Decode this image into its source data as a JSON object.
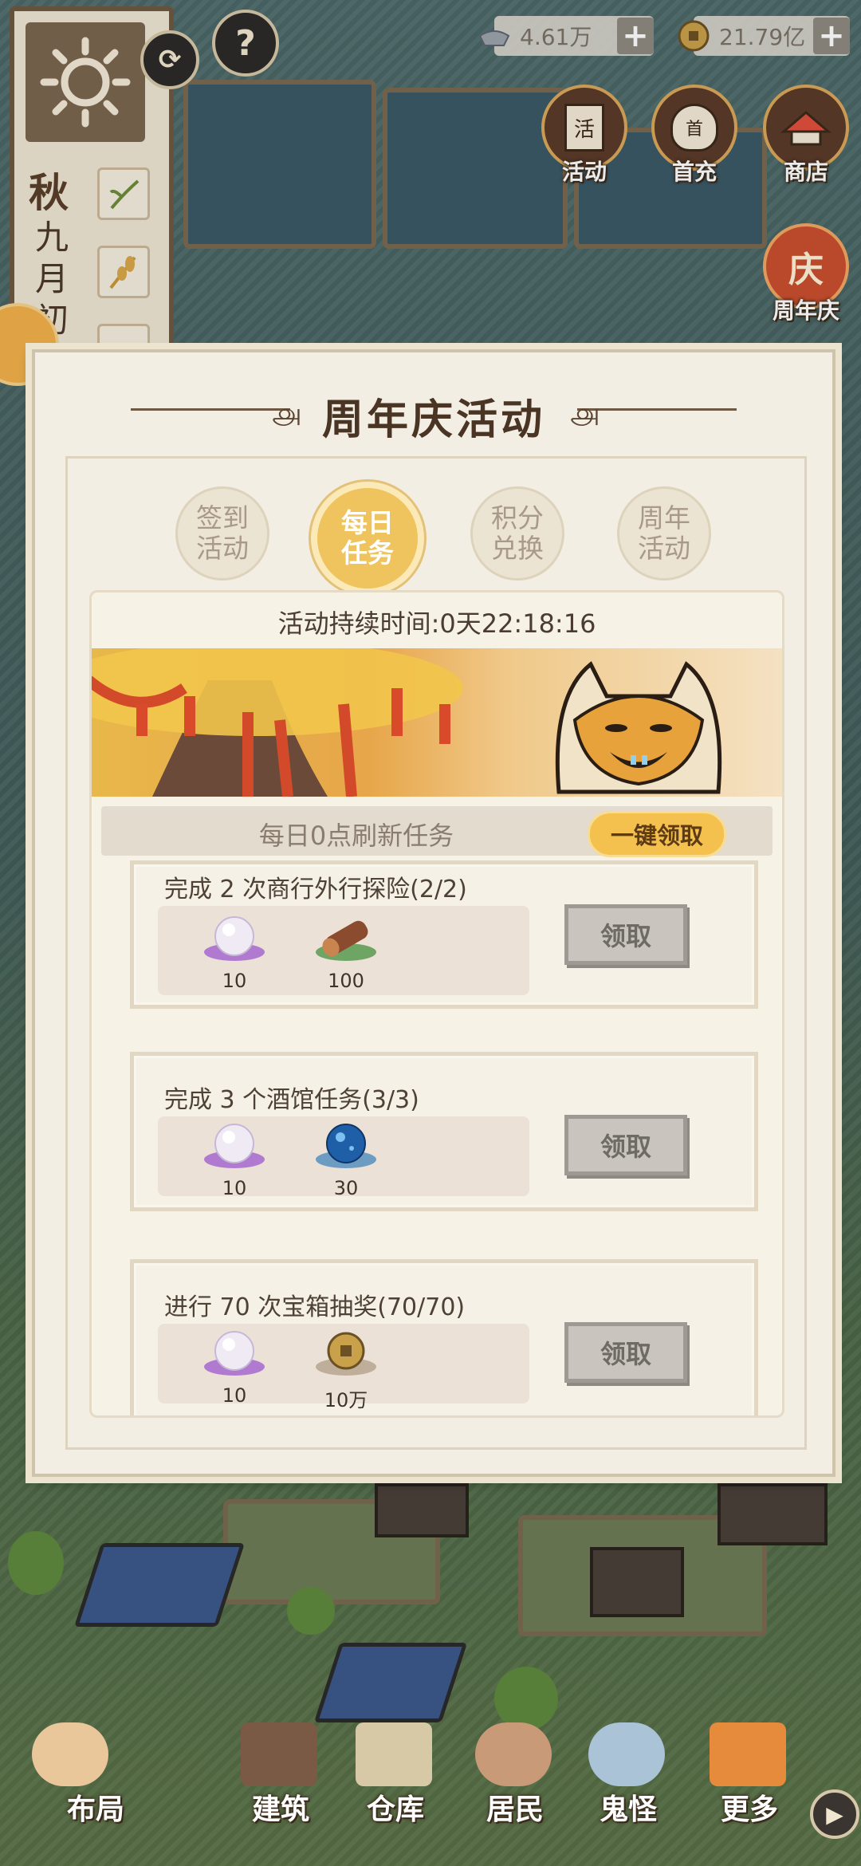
{
  "hud": {
    "season": "秋",
    "date": "九月初二",
    "currency_silver": "4.61万",
    "currency_copper": "21.79亿",
    "plus_label": "+",
    "help_label": "?"
  },
  "top_menu": {
    "activity": "活动",
    "activity_glyph": "活",
    "first_charge": "首充",
    "first_charge_glyph": "首",
    "shop": "商店",
    "anniversary": "周年庆",
    "anniversary_glyph": "庆"
  },
  "modal": {
    "title": "周年庆活动",
    "tabs": [
      {
        "label": "签到活动",
        "active": false
      },
      {
        "label": "每日任务",
        "active": true
      },
      {
        "label": "积分兑换",
        "active": false
      },
      {
        "label": "周年活动",
        "active": false
      }
    ],
    "duration": "活动持续时间:0天22:18:16",
    "refresh_text": "每日0点刷新任务",
    "claim_all": "一键领取",
    "tasks": [
      {
        "title": "完成 2 次商行外行探险(2/2)",
        "rewards": [
          {
            "icon": "pearl-icon",
            "amount": "10"
          },
          {
            "icon": "log-icon",
            "amount": "100"
          }
        ],
        "claim": "领取"
      },
      {
        "title": "完成 3 个酒馆任务(3/3)",
        "rewards": [
          {
            "icon": "pearl-icon",
            "amount": "10"
          },
          {
            "icon": "blue-orb-icon",
            "amount": "30"
          }
        ],
        "claim": "领取"
      },
      {
        "title": "进行 70 次宝箱抽奖(70/70)",
        "rewards": [
          {
            "icon": "pearl-icon",
            "amount": "10"
          },
          {
            "icon": "coin-icon",
            "amount": "10万"
          }
        ],
        "claim": "领取"
      }
    ]
  },
  "bottom_bar": {
    "layout": "布局",
    "build": "建筑",
    "warehouse": "仓库",
    "residents": "居民",
    "ghosts": "鬼怪",
    "more": "更多"
  },
  "colors": {
    "accent_gold": "#efc35d",
    "modal_bg": "#f3eee3",
    "title_brown": "#4a3424",
    "disabled_btn": "#c9c5be"
  }
}
